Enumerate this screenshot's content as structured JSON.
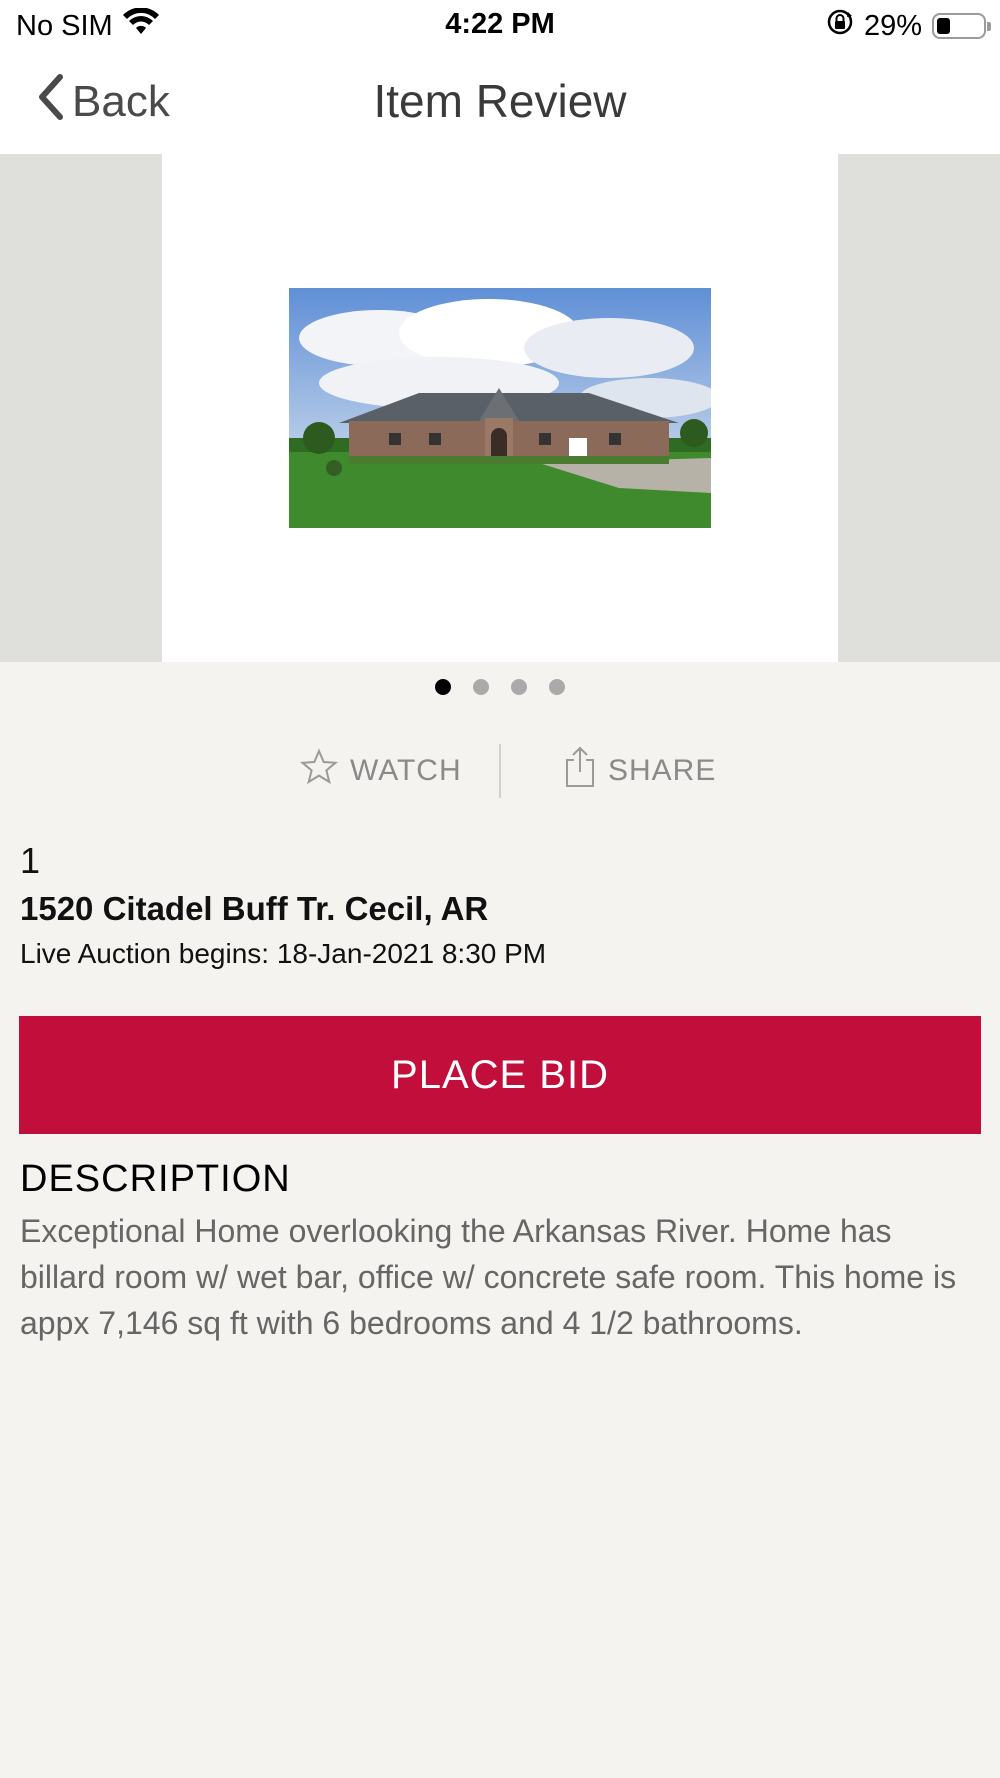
{
  "status_bar": {
    "carrier": "No SIM",
    "time": "4:22 PM",
    "battery_percent": "29%",
    "battery_level": 0.29,
    "icons": [
      "wifi-icon",
      "rotation-lock-icon",
      "battery-icon"
    ]
  },
  "nav": {
    "back_label": "Back",
    "title": "Item Review"
  },
  "gallery": {
    "image_count": 4,
    "active_index": 0,
    "image_subject": "house-photo"
  },
  "actions": {
    "watch_label": "WATCH",
    "share_label": "SHARE",
    "watch_icon": "star-outline-icon",
    "share_icon": "share-icon"
  },
  "item": {
    "lot_number": "1",
    "title": "1520 Citadel Buff Tr. Cecil, AR",
    "auction_info": "Live Auction begins: 18-Jan-2021 8:30 PM"
  },
  "bid_button_label": "PLACE BID",
  "description": {
    "heading": "DESCRIPTION",
    "body": "Exceptional Home overlooking the Arkansas River. Home has billard room w/ wet bar, office w/ concrete safe room. This home is appx 7,146 sq ft with 6 bedrooms and 4 1/2 bathrooms."
  },
  "colors": {
    "accent": "#c20e3a",
    "background": "#f4f3f0",
    "muted_text": "#8a8a8a"
  }
}
